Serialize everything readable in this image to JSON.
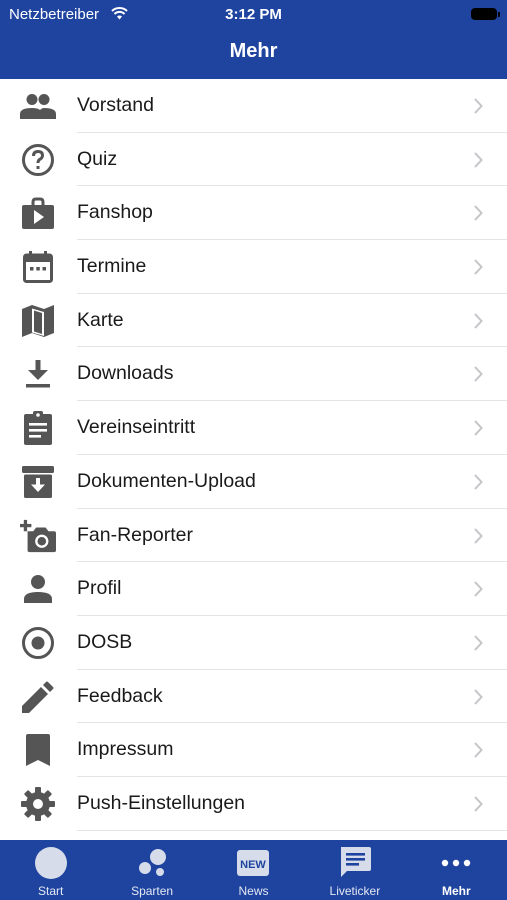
{
  "status_bar": {
    "carrier": "Netzbetreiber",
    "time": "3:12 PM"
  },
  "header": {
    "title": "Mehr"
  },
  "menu": {
    "items": [
      {
        "label": "Vorstand",
        "icon": "group-icon"
      },
      {
        "label": "Quiz",
        "icon": "help-circle-icon"
      },
      {
        "label": "Fanshop",
        "icon": "shop-bag-icon"
      },
      {
        "label": "Termine",
        "icon": "calendar-icon"
      },
      {
        "label": "Karte",
        "icon": "map-icon"
      },
      {
        "label": "Downloads",
        "icon": "download-icon"
      },
      {
        "label": "Vereinseintritt",
        "icon": "clipboard-icon"
      },
      {
        "label": "Dokumenten-Upload",
        "icon": "archive-icon"
      },
      {
        "label": "Fan-Reporter",
        "icon": "add-camera-icon"
      },
      {
        "label": "Profil",
        "icon": "person-icon"
      },
      {
        "label": "DOSB",
        "icon": "radio-button-icon"
      },
      {
        "label": "Feedback",
        "icon": "pencil-icon"
      },
      {
        "label": "Impressum",
        "icon": "bookmark-icon"
      },
      {
        "label": "Push-Einstellungen",
        "icon": "gear-icon"
      }
    ]
  },
  "tabbar": {
    "tabs": [
      {
        "label": "Start",
        "icon": "club-logo-icon"
      },
      {
        "label": "Sparten",
        "icon": "dots-cluster-icon"
      },
      {
        "label": "News",
        "icon": "new-badge-icon"
      },
      {
        "label": "Liveticker",
        "icon": "chat-icon"
      },
      {
        "label": "Mehr",
        "icon": "more-dots-icon",
        "active": true
      }
    ],
    "active_tab": "Mehr"
  },
  "colors": {
    "primary": "#1f44a0",
    "icon_gray": "#555555",
    "chevron": "#c4c4c9"
  }
}
